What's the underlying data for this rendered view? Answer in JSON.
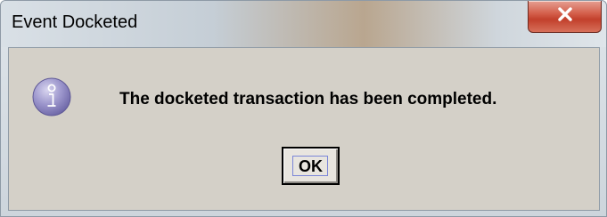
{
  "window": {
    "title": "Event Docketed",
    "close_icon": "close-icon"
  },
  "dialog": {
    "icon": "info-icon",
    "message": "The docketed transaction has been completed.",
    "ok_label": "OK"
  },
  "colors": {
    "close_button": "#c7432e",
    "client_background": "#d4d0c8",
    "icon_tint": "#8a84c0"
  }
}
